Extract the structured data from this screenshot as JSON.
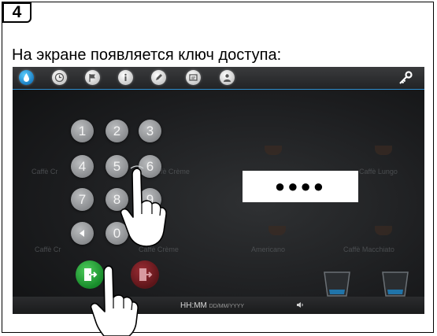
{
  "step": {
    "number": "4"
  },
  "caption": "На экране появляется ключ доступа:",
  "topbar": {
    "icons": [
      {
        "name": "water-drop-icon"
      },
      {
        "name": "clock-icon"
      },
      {
        "name": "flag-icon"
      },
      {
        "name": "info-icon"
      },
      {
        "name": "pencil-icon"
      },
      {
        "name": "screen-icon"
      },
      {
        "name": "user-icon"
      }
    ],
    "key_icon": "key-icon"
  },
  "background_drinks": [
    "Caffè Cr",
    "Caffè Crème",
    "Americano",
    "Caffè Macchiato",
    "Caffè Lungo"
  ],
  "keypad": {
    "keys": [
      "1",
      "2",
      "3",
      "4",
      "5",
      "6",
      "7",
      "8",
      "9",
      "0"
    ],
    "back_icon": "backspace-icon"
  },
  "pin": {
    "masked": "●●●●"
  },
  "actions": {
    "confirm": "exit-door-green-icon",
    "cancel": "exit-door-red-icon"
  },
  "statusbar": {
    "time": "HH:MM",
    "date": "DD/MM/YYYY"
  },
  "colors": {
    "accent": "#2f8fd0",
    "confirm": "#1e9a30",
    "cancel": "#7a1f26"
  }
}
